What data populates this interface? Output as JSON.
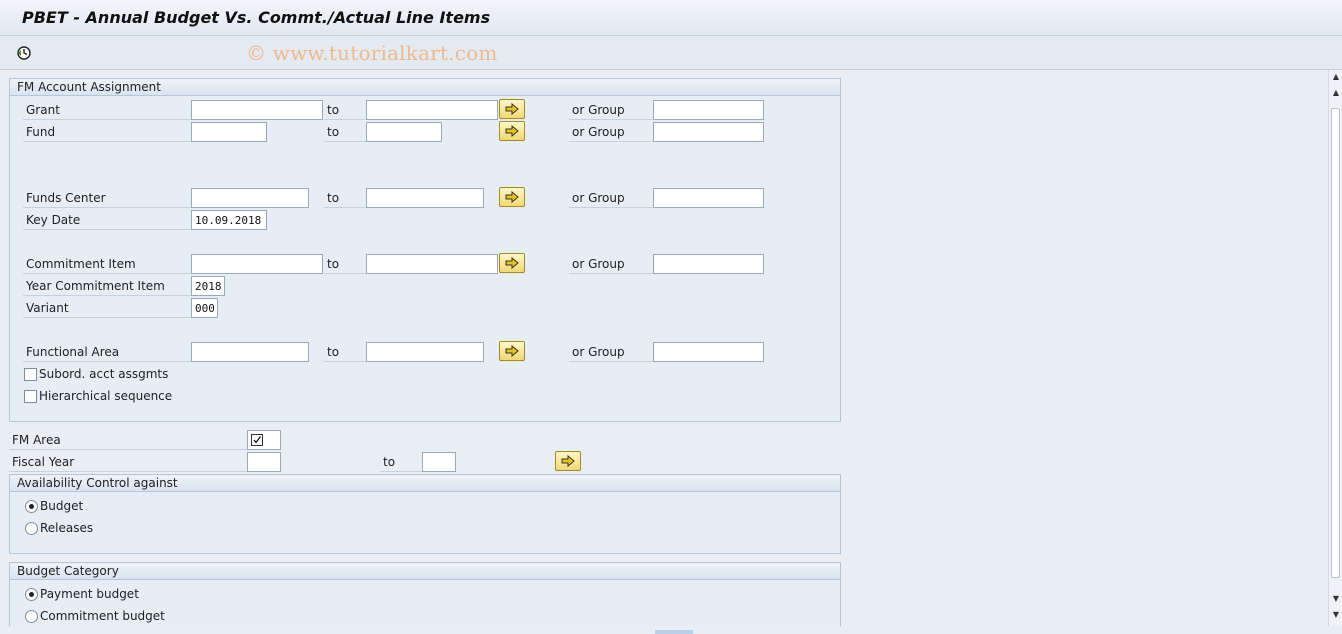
{
  "window": {
    "title": "PBET - Annual Budget Vs. Commt./Actual Line Items"
  },
  "toolbar": {
    "watermark": "© www.tutorialkart.com",
    "execute_icon": "execute-clock-icon"
  },
  "fm_account": {
    "header": "FM Account Assignment",
    "to_label": "to",
    "or_group_label": "or Group",
    "grant": {
      "label": "Grant",
      "from": "",
      "to": "",
      "group": ""
    },
    "fund": {
      "label": "Fund",
      "from": "",
      "to": "",
      "group": ""
    },
    "funds_center": {
      "label": "Funds Center",
      "from": "",
      "to": "",
      "group": ""
    },
    "key_date": {
      "label": "Key Date",
      "value": "10.09.2018"
    },
    "commitment_item": {
      "label": "Commitment Item",
      "from": "",
      "to": "",
      "group": ""
    },
    "year_commitment_item": {
      "label": "Year Commitment Item",
      "value": "2018"
    },
    "variant": {
      "label": "Variant",
      "value": "000"
    },
    "functional_area": {
      "label": "Functional Area",
      "from": "",
      "to": "",
      "group": ""
    },
    "subord": {
      "label": "Subord. acct assgmts",
      "checked": false
    },
    "hierarchical": {
      "label": "Hierarchical sequence",
      "checked": false
    }
  },
  "fm_area": {
    "label": "FM Area",
    "value": ""
  },
  "fiscal_year": {
    "label": "Fiscal Year",
    "from": "",
    "to_label": "to",
    "to": ""
  },
  "availability": {
    "header": "Availability Control against",
    "options": [
      "Budget",
      "Releases"
    ],
    "selected": "Budget"
  },
  "budget_category": {
    "header": "Budget Category",
    "options": [
      "Payment budget",
      "Commitment budget"
    ],
    "selected": "Payment budget"
  },
  "colors": {
    "accent_button": "#f1d874",
    "group_bg": "#e6edf5",
    "watermark": "#f0b98c"
  }
}
